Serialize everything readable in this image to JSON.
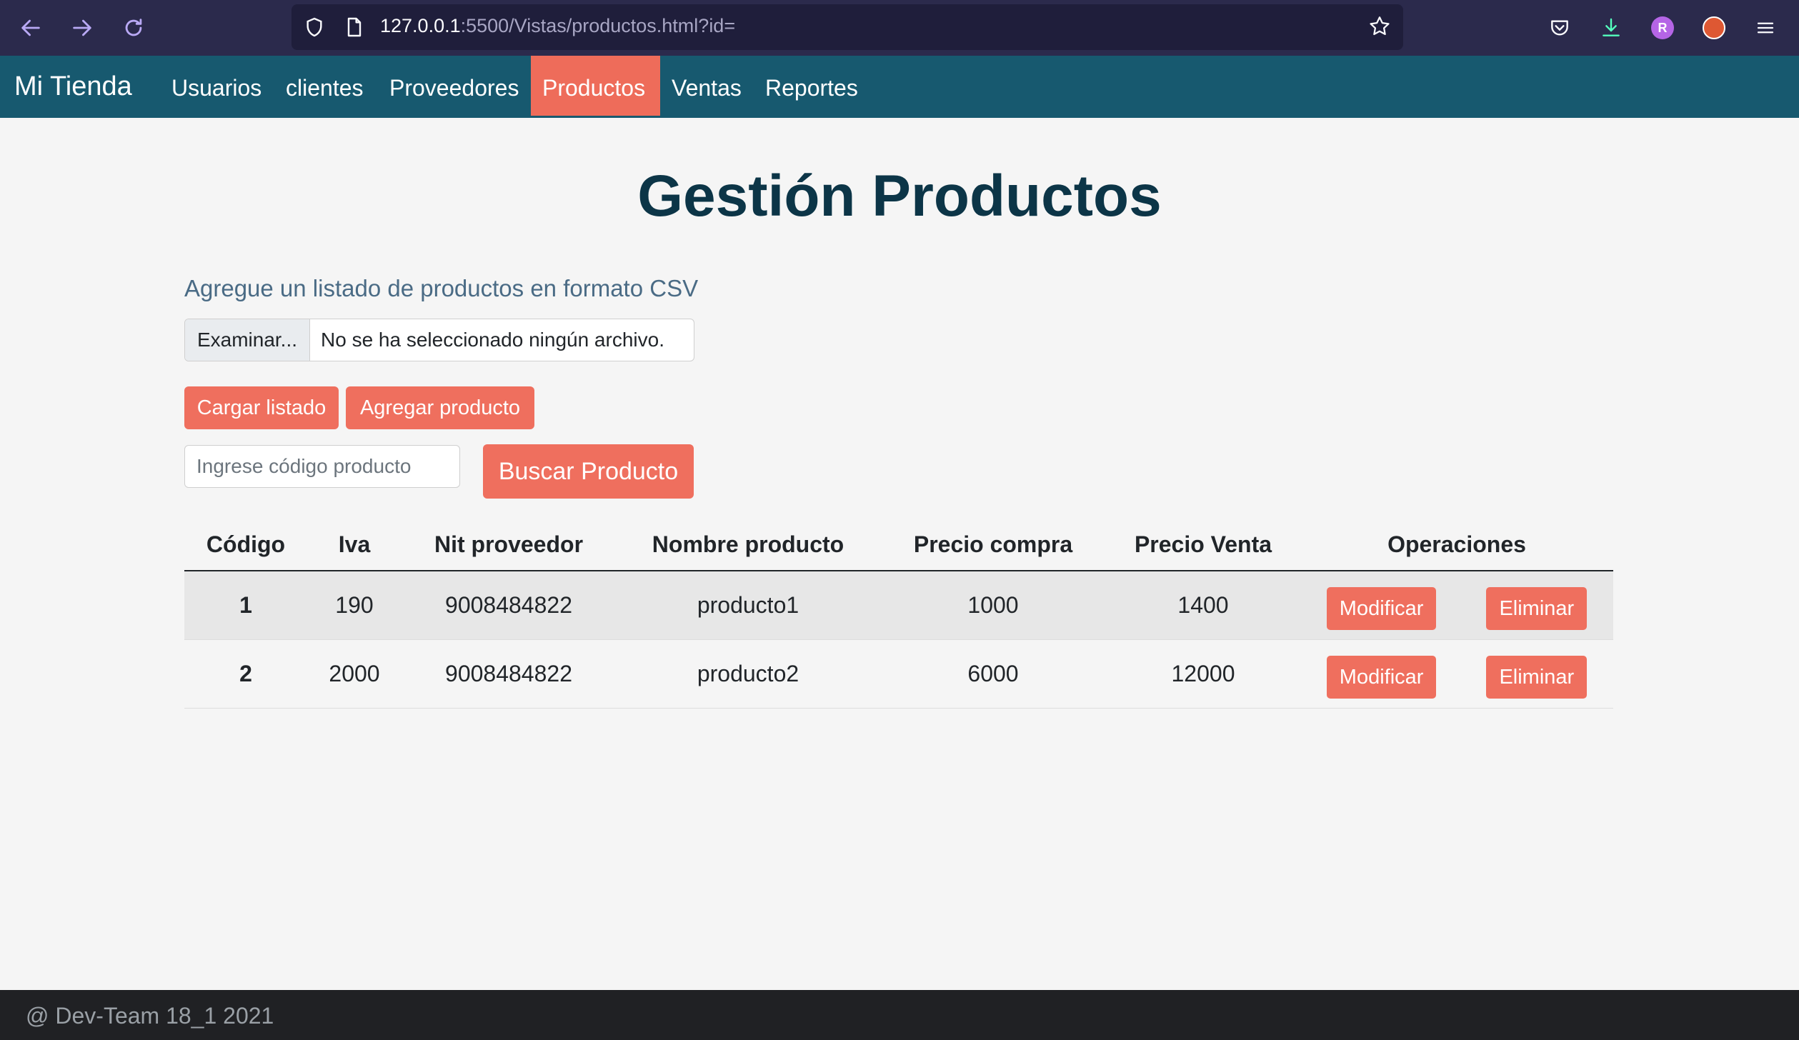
{
  "browser": {
    "url_host": "127.0.0.1",
    "url_rest": ":5500/Vistas/productos.html?id=",
    "profile_initial": "R"
  },
  "navbar": {
    "brand": "Mi Tienda",
    "items": [
      {
        "label": "Usuarios",
        "active": false
      },
      {
        "label": "clientes",
        "active": false
      },
      {
        "label": "Proveedores",
        "active": false
      },
      {
        "label": "Productos",
        "active": true
      },
      {
        "label": "Ventas",
        "active": false
      },
      {
        "label": "Reportes",
        "active": false
      }
    ]
  },
  "page": {
    "title": "Gestión Productos",
    "csv_label": "Agregue un listado de productos en formato CSV",
    "file_button": "Examinar...",
    "file_status": "No se ha seleccionado ningún archivo.",
    "load_list_button": "Cargar listado",
    "add_product_button": "Agregar producto",
    "search_placeholder": "Ingrese código producto",
    "search_button": "Buscar Producto"
  },
  "table": {
    "headers": [
      "Código",
      "Iva",
      "Nit proveedor",
      "Nombre producto",
      "Precio compra",
      "Precio Venta",
      "Operaciones"
    ],
    "rows": [
      {
        "codigo": "1",
        "iva": "190",
        "nit": "9008484822",
        "nombre": "producto1",
        "compra": "1000",
        "venta": "1400",
        "modify": "Modificar",
        "delete": "Eliminar"
      },
      {
        "codigo": "2",
        "iva": "2000",
        "nit": "9008484822",
        "nombre": "producto2",
        "compra": "6000",
        "venta": "12000",
        "modify": "Modificar",
        "delete": "Eliminar"
      }
    ]
  },
  "footer": {
    "text": "@ Dev-Team 18_1 2021"
  },
  "colors": {
    "navbar": "#17596f",
    "accent": "#ef6f5e",
    "title": "#0c3547",
    "footer": "#202124"
  }
}
